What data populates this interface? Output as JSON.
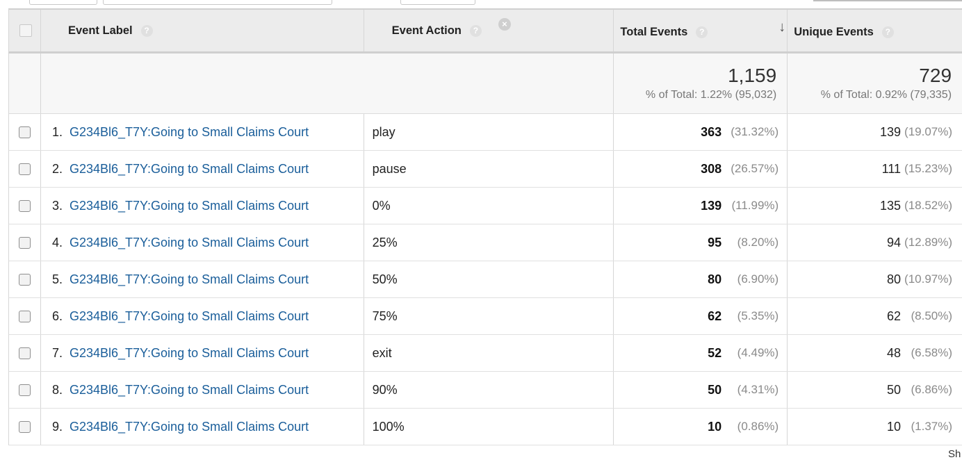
{
  "header": {
    "event_label": "Event Label",
    "event_action": "Event Action",
    "total_events": "Total Events",
    "unique_events": "Unique Events",
    "help_glyph": "?",
    "remove_glyph": "×",
    "sort_glyph": "↓"
  },
  "summary": {
    "total_value": "1,159",
    "total_pct": "% of Total: 1.22% (95,032)",
    "unique_value": "729",
    "unique_pct": "% of Total: 0.92% (79,335)"
  },
  "rows": [
    {
      "num": "1.",
      "label": "G234Bl6_T7Y:Going to Small Claims Court",
      "action": "play",
      "total": "363",
      "total_pct": "(31.32%)",
      "unique": "139",
      "unique_pct": "(19.07%)"
    },
    {
      "num": "2.",
      "label": "G234Bl6_T7Y:Going to Small Claims Court",
      "action": "pause",
      "total": "308",
      "total_pct": "(26.57%)",
      "unique": "111",
      "unique_pct": "(15.23%)"
    },
    {
      "num": "3.",
      "label": "G234Bl6_T7Y:Going to Small Claims Court",
      "action": "0%",
      "total": "139",
      "total_pct": "(11.99%)",
      "unique": "135",
      "unique_pct": "(18.52%)"
    },
    {
      "num": "4.",
      "label": "G234Bl6_T7Y:Going to Small Claims Court",
      "action": "25%",
      "total": "95",
      "total_pct": "(8.20%)",
      "unique": "94",
      "unique_pct": "(12.89%)"
    },
    {
      "num": "5.",
      "label": "G234Bl6_T7Y:Going to Small Claims Court",
      "action": "50%",
      "total": "80",
      "total_pct": "(6.90%)",
      "unique": "80",
      "unique_pct": "(10.97%)"
    },
    {
      "num": "6.",
      "label": "G234Bl6_T7Y:Going to Small Claims Court",
      "action": "75%",
      "total": "62",
      "total_pct": "(5.35%)",
      "unique": "62",
      "unique_pct": "(8.50%)"
    },
    {
      "num": "7.",
      "label": "G234Bl6_T7Y:Going to Small Claims Court",
      "action": "exit",
      "total": "52",
      "total_pct": "(4.49%)",
      "unique": "48",
      "unique_pct": "(6.58%)"
    },
    {
      "num": "8.",
      "label": "G234Bl6_T7Y:Going to Small Claims Court",
      "action": "90%",
      "total": "50",
      "total_pct": "(4.31%)",
      "unique": "50",
      "unique_pct": "(6.86%)"
    },
    {
      "num": "9.",
      "label": "G234Bl6_T7Y:Going to Small Claims Court",
      "action": "100%",
      "total": "10",
      "total_pct": "(0.86%)",
      "unique": "10",
      "unique_pct": "(1.37%)"
    }
  ],
  "footer": {
    "partial_text": "Sh"
  }
}
